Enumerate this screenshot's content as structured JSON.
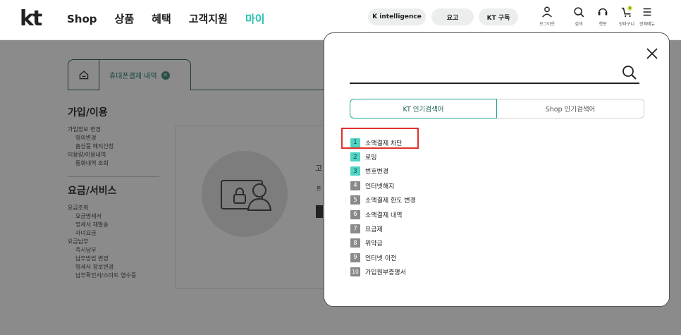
{
  "header": {
    "logo": "kt",
    "nav": [
      "Shop",
      "상품",
      "혜택",
      "고객지원",
      "마이"
    ],
    "nav_active_index": 4,
    "pills": [
      "K intelligence",
      "요고",
      "KT 구독"
    ],
    "utilities": [
      {
        "label": "로그아웃",
        "icon": "user-icon"
      },
      {
        "label": "검색",
        "icon": "search-icon"
      },
      {
        "label": "챗봇",
        "icon": "chatbot-icon"
      },
      {
        "label": "장바구니",
        "icon": "cart-icon",
        "badge": "0"
      },
      {
        "label": "전체메뉴",
        "icon": "menu-icon"
      }
    ],
    "accent_color": "#1fc2ae"
  },
  "background": {
    "tab_label": "휴대폰결제 내역",
    "sections": [
      {
        "title": "가입/이용",
        "items": [
          {
            "label": "가입정보 변경",
            "sub": false
          },
          {
            "label": "명의변경",
            "sub": true
          },
          {
            "label": "홈상품 해지신청",
            "sub": true
          },
          {
            "label": "이용량/이용내역",
            "sub": false
          },
          {
            "label": "통화내역 조회",
            "sub": true
          }
        ]
      },
      {
        "title": "요금/서비스",
        "items": [
          {
            "label": "요금조회",
            "sub": false
          },
          {
            "label": "요금명세서",
            "sub": true
          },
          {
            "label": "명세서 재발송",
            "sub": true
          },
          {
            "label": "자녀요금",
            "sub": true
          },
          {
            "label": "요금납부",
            "sub": false
          },
          {
            "label": "즉시납부",
            "sub": true
          },
          {
            "label": "납부방법 변경",
            "sub": true
          },
          {
            "label": "명세서 정보변경",
            "sub": true
          },
          {
            "label": "납부확인서/스마트 영수증",
            "sub": true
          }
        ]
      }
    ],
    "card_text_a": "고",
    "card_text_b": "본"
  },
  "search_modal": {
    "placeholder": "",
    "tabs": [
      "KT 인기검색어",
      "Shop 인기검색어"
    ],
    "active_tab": 0,
    "popular_terms": [
      {
        "rank": "1",
        "label": "소액결제 차단"
      },
      {
        "rank": "2",
        "label": "로밍"
      },
      {
        "rank": "3",
        "label": "번호변경"
      },
      {
        "rank": "4",
        "label": "인터넷해지"
      },
      {
        "rank": "5",
        "label": "소액결제 한도 변경"
      },
      {
        "rank": "6",
        "label": "소액결제 내역"
      },
      {
        "rank": "7",
        "label": "요금제"
      },
      {
        "rank": "8",
        "label": "위약금"
      },
      {
        "rank": "9",
        "label": "인터넷 이전"
      },
      {
        "rank": "10",
        "label": "가입원부증명서"
      }
    ],
    "highlighted_rank": "1",
    "highlight_color": "#e0312b"
  }
}
